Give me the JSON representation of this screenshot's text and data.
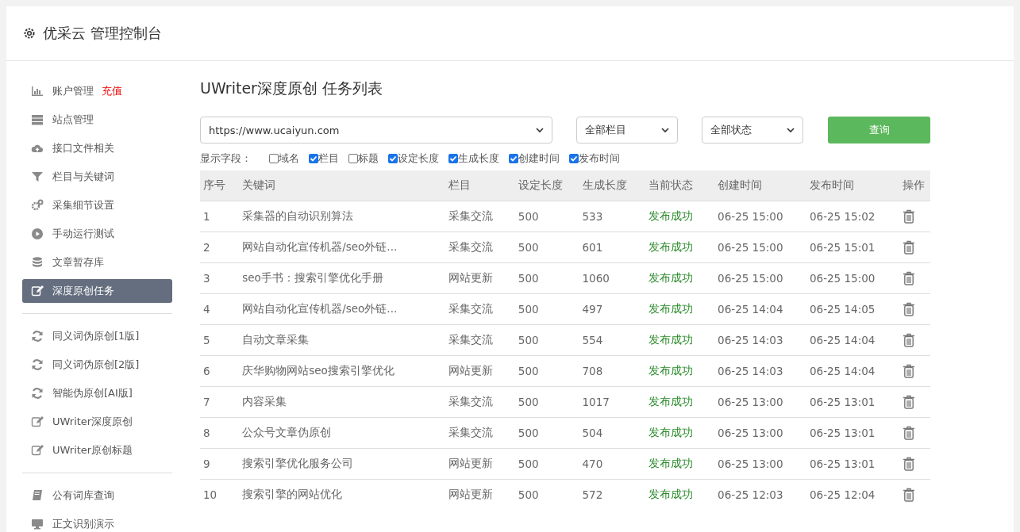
{
  "header": {
    "title": "优采云 管理控制台"
  },
  "sidebar": {
    "groups": [
      {
        "items": [
          {
            "label": "账户管理",
            "badge": "充值",
            "selected": false
          },
          {
            "label": "站点管理",
            "selected": false
          },
          {
            "label": "接口文件相关",
            "selected": false
          },
          {
            "label": "栏目与关键词",
            "selected": false
          },
          {
            "label": "采集细节设置",
            "selected": false
          },
          {
            "label": "手动运行测试",
            "selected": false
          },
          {
            "label": "文章暂存库",
            "selected": false
          },
          {
            "label": "深度原创任务",
            "selected": true
          }
        ]
      },
      {
        "items": [
          {
            "label": "同义词伪原创[1版]",
            "selected": false
          },
          {
            "label": "同义词伪原创[2版]",
            "selected": false
          },
          {
            "label": "智能伪原创[AI版]",
            "selected": false
          },
          {
            "label": "UWriter深度原创",
            "selected": false
          },
          {
            "label": "UWriter原创标题",
            "selected": false
          }
        ]
      },
      {
        "items": [
          {
            "label": "公有词库查询",
            "selected": false
          },
          {
            "label": "正文识别演示",
            "selected": false
          }
        ]
      }
    ]
  },
  "page_title": "UWriter深度原创 任务列表",
  "filters": {
    "site": "https://www.ucaiyun.com",
    "column": "全部栏目",
    "status": "全部状态",
    "button": "查询"
  },
  "fields": {
    "label": "显示字段：",
    "options": [
      {
        "label": "域名",
        "checked": false
      },
      {
        "label": "栏目",
        "checked": true
      },
      {
        "label": "标题",
        "checked": false
      },
      {
        "label": "设定长度",
        "checked": true
      },
      {
        "label": "生成长度",
        "checked": true
      },
      {
        "label": "创建时间",
        "checked": true
      },
      {
        "label": "发布时间",
        "checked": true
      }
    ]
  },
  "table": {
    "columns": [
      "序号",
      "关键词",
      "栏目",
      "设定长度",
      "生成长度",
      "当前状态",
      "创建时间",
      "发布时间",
      "操作"
    ],
    "rows": [
      [
        "1",
        "采集器的自动识别算法",
        "采集交流",
        "500",
        "533",
        "发布成功",
        "06-25 15:00",
        "06-25 15:02"
      ],
      [
        "2",
        "网站自动化宣传机器/seo外链...",
        "采集交流",
        "500",
        "601",
        "发布成功",
        "06-25 15:00",
        "06-25 15:01"
      ],
      [
        "3",
        "seo手书：搜索引擎优化手册",
        "网站更新",
        "500",
        "1060",
        "发布成功",
        "06-25 15:00",
        "06-25 15:00"
      ],
      [
        "4",
        "网站自动化宣传机器/seo外链...",
        "采集交流",
        "500",
        "497",
        "发布成功",
        "06-25 14:04",
        "06-25 14:05"
      ],
      [
        "5",
        "自动文章采集",
        "采集交流",
        "500",
        "554",
        "发布成功",
        "06-25 14:03",
        "06-25 14:04"
      ],
      [
        "6",
        "庆华购物网站seo搜索引擎优化",
        "网站更新",
        "500",
        "708",
        "发布成功",
        "06-25 14:03",
        "06-25 14:04"
      ],
      [
        "7",
        "内容采集",
        "采集交流",
        "500",
        "1017",
        "发布成功",
        "06-25 13:00",
        "06-25 13:01"
      ],
      [
        "8",
        "公众号文章伪原创",
        "采集交流",
        "500",
        "504",
        "发布成功",
        "06-25 13:00",
        "06-25 13:01"
      ],
      [
        "9",
        "搜索引擎优化服务公司",
        "网站更新",
        "500",
        "470",
        "发布成功",
        "06-25 13:00",
        "06-25 13:01"
      ],
      [
        "10",
        "搜索引擎的网站优化",
        "网站更新",
        "500",
        "572",
        "发布成功",
        "06-25 12:03",
        "06-25 12:04"
      ]
    ]
  }
}
